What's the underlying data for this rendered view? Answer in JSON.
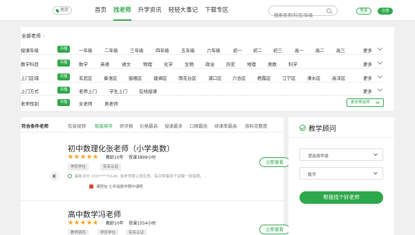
{
  "header": {
    "city": "南京",
    "nav": [
      "首页",
      "找老师",
      "升学资讯",
      "轻轻大事记",
      "下载专区"
    ],
    "active_nav_index": 1,
    "search_placeholder": "搜索老师/科目/年级",
    "login_label": "登录",
    "register_label": "注册"
  },
  "filters": {
    "heading": "全部老师",
    "more_label": "更多",
    "more_filters_label": "更多筛选项",
    "rows": [
      {
        "label": "授课年级",
        "all": "不限",
        "options": [
          "一年级",
          "二年级",
          "三年级",
          "四年级",
          "五年级",
          "六年级",
          "初一",
          "初二",
          "初三",
          "高一",
          "高二",
          "高三"
        ]
      },
      {
        "label": "教学科目",
        "all": "不限",
        "options": [
          "数学",
          "英语",
          "语文",
          "物理",
          "化学",
          "生物",
          "政治",
          "历史",
          "地理",
          "奥数",
          "科学"
        ]
      },
      {
        "label": "上门区域",
        "all": "不限",
        "options": [
          "玄武区",
          "秦淮区",
          "鼓楼区",
          "建邺区",
          "雨花台区",
          "浦口区",
          "六合区",
          "栖霞区",
          "江宁区",
          "溧水区",
          "高淳区"
        ]
      },
      {
        "label": "上门方式",
        "all": "不限",
        "options": [
          "老师上门",
          "学生上门",
          "在线授课"
        ]
      },
      {
        "label": "老师性别",
        "all": "不限",
        "options": [
          "女老师",
          "男老师"
        ]
      }
    ]
  },
  "results": {
    "title": "符合条件老师",
    "sorts": [
      "有音视频",
      "智能排序",
      "好评数",
      "价格最高",
      "授课最多",
      "口碑最佳",
      "续课率最高",
      "资料完整度"
    ],
    "active_sort_index": 1,
    "view_label": "立即查看",
    "teachers": [
      {
        "name": "初中数理化张老师（小学奥数）",
        "rating": 5,
        "teaching_years": "教龄10年",
        "hours": "授课3899小时",
        "tags": [
          "学历学位",
          "实名认证"
        ],
        "review": "最新评价 159*****5146: 张老师很认真负责，每次帮着孩子讲解一周错题。...",
        "course": "课程包 七年级数学期中课程"
      },
      {
        "name": "高中数学冯老师",
        "rating": 5,
        "teaching_years": "教龄10年",
        "hours": "授课1554小时",
        "tags": [
          "教师资历",
          "学历学位",
          "实名认证"
        ]
      }
    ]
  },
  "advisor": {
    "title": "教学顾问",
    "grade_placeholder": "请选择年级",
    "subject_value": "数学",
    "button_label": "帮我找个好老师"
  },
  "colors": {
    "brand_green": "#2ea84b",
    "star": "#f5a623",
    "background": "#f0f0f0"
  }
}
